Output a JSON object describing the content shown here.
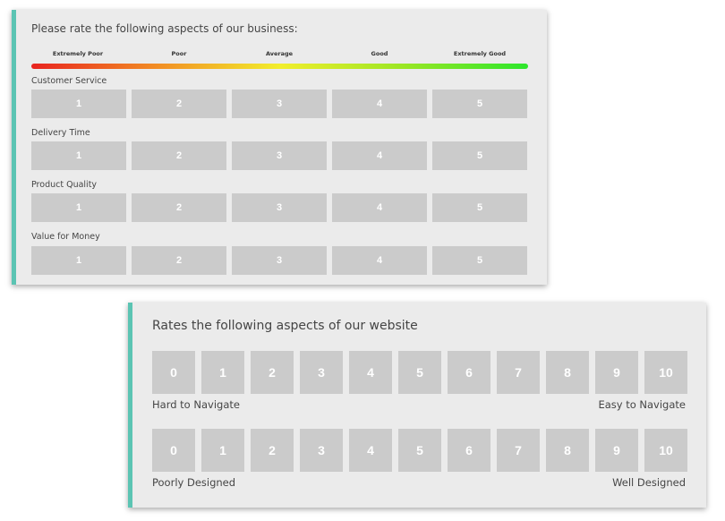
{
  "business_card": {
    "title": "Please rate the following aspects of our business:",
    "scale_labels": [
      "Extremely Poor",
      "Poor",
      "Average",
      "Good",
      "Extremely Good"
    ],
    "options": [
      "1",
      "2",
      "3",
      "4",
      "5"
    ],
    "questions": [
      "Customer Service",
      "Delivery Time",
      "Product Quality",
      "Value for Money"
    ]
  },
  "website_card": {
    "title": "Rates the following aspects of our website",
    "options": [
      "0",
      "1",
      "2",
      "3",
      "4",
      "5",
      "6",
      "7",
      "8",
      "9",
      "10"
    ],
    "questions": [
      {
        "low_label": "Hard to Navigate",
        "high_label": "Easy to Navigate"
      },
      {
        "low_label": "Poorly Designed",
        "high_label": "Well Designed"
      }
    ]
  },
  "colors": {
    "card_background": "#ebebeb",
    "accent": "#5bc4b3",
    "button_background": "#cbcbcb",
    "button_text": "#ffffff",
    "gradient": [
      "#e8231f",
      "#f28c24",
      "#f2ee2c",
      "#9ae624",
      "#2ce62c"
    ]
  }
}
